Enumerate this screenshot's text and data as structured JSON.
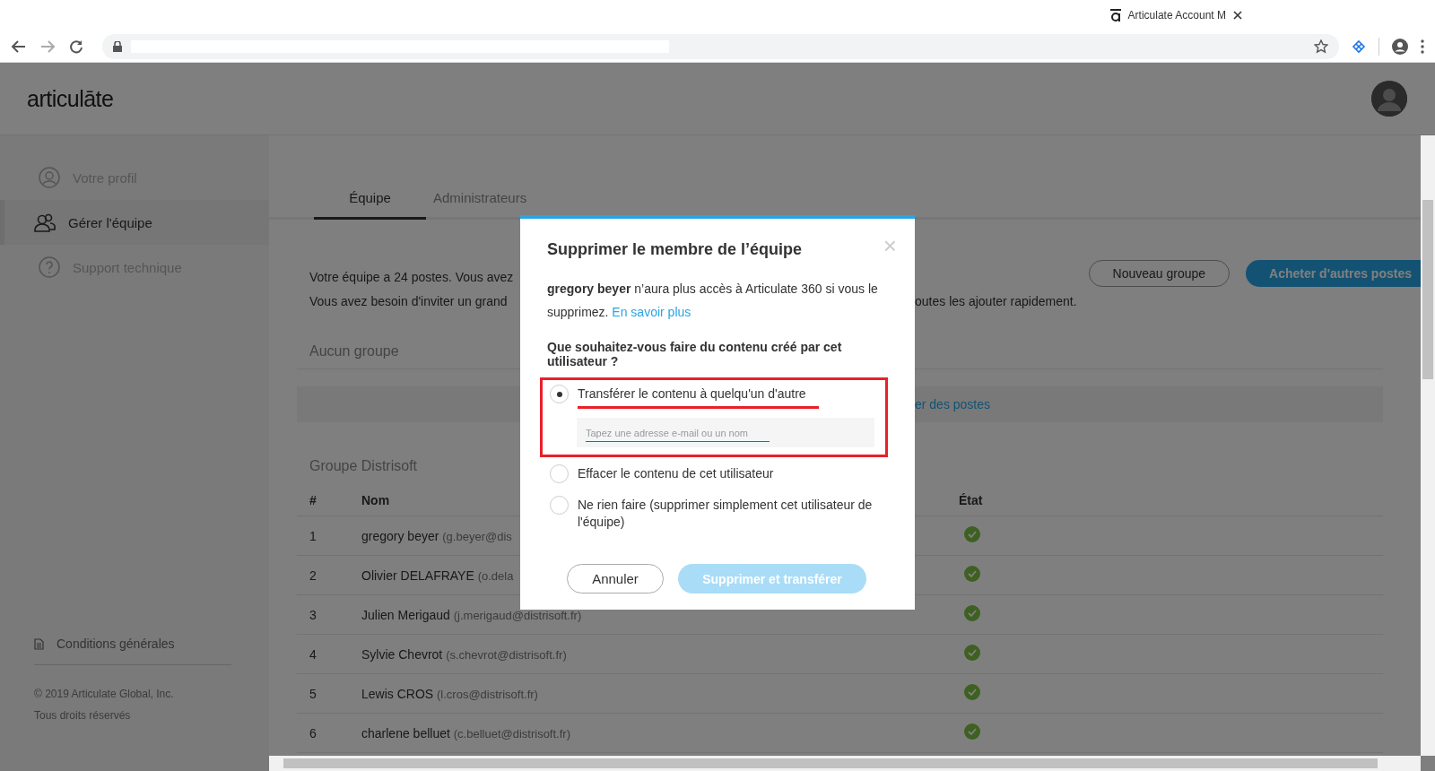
{
  "browser": {
    "tab_title": "Articulate Account M"
  },
  "header": {
    "logo": "articulāte"
  },
  "sidebar": {
    "items": [
      {
        "kind": "profile",
        "label": "Votre profil",
        "selected": false
      },
      {
        "kind": "team",
        "label": "Gérer l'équipe",
        "selected": true
      },
      {
        "kind": "help",
        "label": "Support technique",
        "selected": false
      }
    ],
    "terms": "Conditions générales",
    "copyright": "© 2019 Articulate Global, Inc.",
    "rights": "Tous droits réservés"
  },
  "tabs": [
    {
      "label": "Équipe",
      "selected": true
    },
    {
      "label": "Administrateurs",
      "selected": false
    }
  ],
  "intro": {
    "line_1": "Votre équipe a 24 postes. Vous avez",
    "line_2": "Vous avez besoin d'inviter un grand",
    "line_2_end": "outes les ajouter rapidement."
  },
  "buttons": {
    "new_group": "Nouveau groupe",
    "buy_seats": "Acheter d'autres postes"
  },
  "no_group": {
    "title": "Aucun groupe",
    "link": "er des postes"
  },
  "group": {
    "title": "Groupe Distrisoft",
    "columns": [
      "#",
      "Nom",
      "État"
    ],
    "rows": [
      {
        "number": "1",
        "name": "gregory beyer",
        "email": "(g.beyer@dis",
        "active": true
      },
      {
        "number": "2",
        "name": "Olivier DELAFRAYE",
        "email": "(o.dela",
        "active": true
      },
      {
        "number": "3",
        "name": "Julien Merigaud",
        "email": "(j.merigaud@distrisoft.fr)",
        "active": true
      },
      {
        "number": "4",
        "name": "Sylvie Chevrot",
        "email": "(s.chevrot@distrisoft.fr)",
        "active": true
      },
      {
        "number": "5",
        "name": "Lewis CROS",
        "email": "(l.cros@distrisoft.fr)",
        "active": true
      },
      {
        "number": "6",
        "name": "charlene belluet",
        "email": "(c.belluet@distrisoft.fr)",
        "active": true
      }
    ]
  },
  "modal": {
    "title": "Supprimer le membre de l’équipe",
    "close": "×",
    "body": "**gregory beyer** n’aura plus accès à Articulate 360 si vous le supprimez.",
    "link": "En savoir plus",
    "question": "Que souhaitez-vous faire du contenu créé par cet utilisateur ?",
    "options": [
      {
        "label": "Transférer le contenu à quelqu'un d'autre",
        "selected": true,
        "highlighted": true,
        "placeholder": "Tapez une adresse e-mail ou un nom"
      },
      {
        "label": "Effacer le contenu de cet utilisateur",
        "selected": false,
        "highlighted": false
      },
      {
        "label": "Ne rien faire (supprimer simplement cet utilisateur de l'équipe)",
        "selected": false,
        "highlighted": false
      }
    ],
    "cancel": "Annuler",
    "confirm": {
      "label": "Supprimer et transférer",
      "disabled": true
    }
  }
}
